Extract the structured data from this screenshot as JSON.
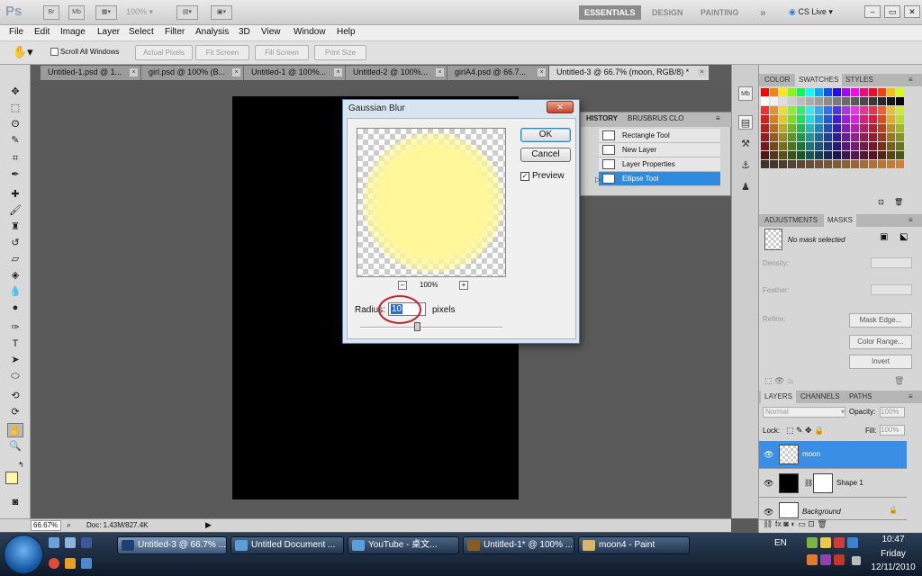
{
  "app": {
    "logo": "Ps",
    "zoom_level": "100%",
    "workspaces": [
      "ESSENTIALS",
      "DESIGN",
      "PAINTING"
    ],
    "more": "»",
    "cs_live": "CS Live ▾",
    "win_buttons": [
      "–",
      "▭",
      "✕"
    ]
  },
  "menu": [
    "File",
    "Edit",
    "Image",
    "Layer",
    "Select",
    "Filter",
    "Analysis",
    "3D",
    "View",
    "Window",
    "Help"
  ],
  "options_bar": {
    "scroll_all": "Scroll All Windows",
    "buttons": [
      "Actual Pixels",
      "Fit Screen",
      "Fill Screen",
      "Print Size"
    ]
  },
  "tabs": [
    {
      "label": "Untitled-1.psd @ 1..."
    },
    {
      "label": "girl.psd @ 100% (B..."
    },
    {
      "label": "Untitled-1 @ 100%..."
    },
    {
      "label": "Untitled-2 @ 100%..."
    },
    {
      "label": "girlA4.psd @ 66.7..."
    },
    {
      "label": "Untitled-3 @ 66.7% (moon, RGB/8) *"
    }
  ],
  "status": {
    "zoom": "66.67%",
    "doc": "Doc: 1.43M/827.4K"
  },
  "dialog": {
    "title": "Gaussian Blur",
    "close": "✕",
    "ok": "OK",
    "cancel": "Cancel",
    "preview_label": "Preview",
    "preview_checked": "✓",
    "zoom_pct": "100%",
    "zoom_minus": "–",
    "zoom_plus": "+",
    "radius_label": "Radius:",
    "radius_value": "10",
    "units": "pixels",
    "preview_color": "#fff79a"
  },
  "history": {
    "tabs": [
      "HISTORY",
      "BRUS",
      "BRUS",
      "CLO"
    ],
    "items": [
      "Rectangle Tool",
      "New Layer",
      "Layer Properties",
      "Ellipse Tool"
    ],
    "selected_index": 3
  },
  "swatches_panel": {
    "tabs": [
      "COLOR",
      "SWATCHES",
      "STYLES"
    ]
  },
  "masks_panel": {
    "tabs": [
      "ADJUSTMENTS",
      "MASKS"
    ],
    "no_mask": "No mask selected",
    "density": "Density:",
    "feather": "Feather:",
    "refine": "Refine:",
    "buttons": [
      "Mask Edge...",
      "Color Range...",
      "Invert"
    ]
  },
  "layers_panel": {
    "tabs": [
      "LAYERS",
      "CHANNELS",
      "PATHS"
    ],
    "blend_mode": "Normal",
    "opacity_label": "Opacity:",
    "opacity": "100%",
    "lock_label": "Lock:",
    "fill_label": "Fill:",
    "fill": "100%",
    "layers": [
      {
        "name": "moon",
        "selected": true
      },
      {
        "name": "Shape 1",
        "selected": false
      },
      {
        "name": "Background",
        "selected": false
      }
    ]
  },
  "taskbar": {
    "buttons": [
      {
        "label": "Untitled-3 @ 66.7% ..."
      },
      {
        "label": "Untitled Document ..."
      },
      {
        "label": "YouTube - 桌文..."
      },
      {
        "label": "Untitled-1* @ 100% ..."
      },
      {
        "label": "moon4 - Paint"
      }
    ],
    "lang": "EN",
    "time": "10:47",
    "day": "Friday",
    "date": "12/11/2010"
  }
}
